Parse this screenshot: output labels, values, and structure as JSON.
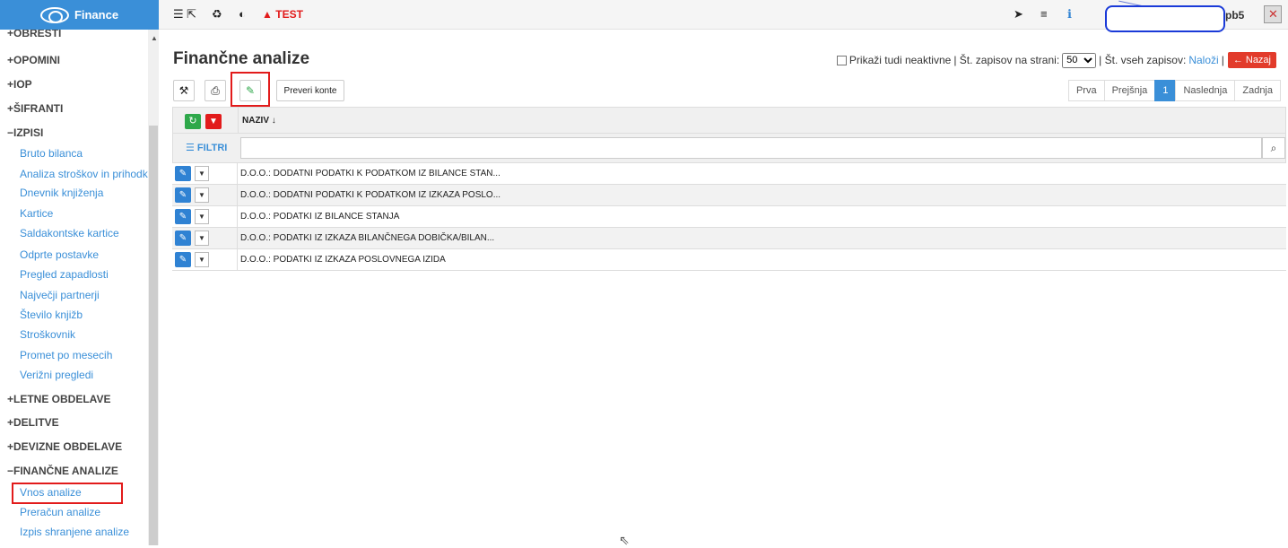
{
  "app": {
    "brand": "Finance",
    "test_label": "TEST",
    "user_suffix": "pb5"
  },
  "sidebar": {
    "sections_top": [
      "OBRESTI",
      "OPOMINI",
      "IOP",
      "ŠIFRANTI",
      "IZPISI"
    ],
    "izpisi_items": [
      "Bruto bilanca",
      "Analiza stroškov in prihodkov",
      "Dnevnik knjiženja",
      "Kartice",
      "Saldakontske kartice",
      "Odprte postavke",
      "Pregled zapadlosti",
      "Največji partnerji",
      "Število knjižb",
      "Stroškovnik",
      "Promet po mesecih",
      "Verižni pregledi"
    ],
    "sections_bottom": [
      "LETNE OBDELAVE",
      "DELITVE",
      "DEVIZNE OBDELAVE",
      "FINANČNE ANALIZE"
    ],
    "fa_items": [
      "Vnos analize",
      "Preračun analize",
      "Izpis shranjene analize"
    ],
    "plus": "+",
    "minus": "−"
  },
  "main": {
    "title": "Finančne analize",
    "show_inactive": "Prikaži tudi neaktivne",
    "per_page_label": "| Št. zapisov na strani:",
    "per_page_value": "50",
    "total_label": "| Št. vseh zapisov:",
    "load_link": "Naloži",
    "back_button": "← Nazaj",
    "check_accounts": "Preveri konte",
    "pager": [
      "Prva",
      "Prejšnja",
      "1",
      "Naslednja",
      "Zadnja"
    ],
    "column_naziv": "NAZIV ↓",
    "filters": "☰ FILTRI",
    "rows": [
      "D.O.O.: DODATNI PODATKI K PODATKOM IZ BILANCE STAN...",
      "D.O.O.: DODATNI PODATKI K PODATKOM IZ IZKAZA POSLO...",
      "D.O.O.: PODATKI IZ BILANCE STANJA",
      "D.O.O.: PODATKI IZ IZKAZA BILANČNEGA DOBIČKA/BILAN...",
      "D.O.O.: PODATKI IZ IZKAZA POSLOVNEGA IZIDA"
    ]
  },
  "colors": {
    "accent": "#3a8fd8",
    "danger": "#e21b1b",
    "success": "#2ea84a"
  },
  "icons": [
    "list-icon",
    "external-link-icon",
    "bag-icon",
    "contrast-icon",
    "warning-icon",
    "send-icon",
    "menu-icon",
    "info-icon",
    "exit-icon",
    "wrench-icon",
    "print-icon",
    "pencil-icon",
    "refresh-icon",
    "filter-icon",
    "search-icon",
    "chevron-down-icon"
  ]
}
